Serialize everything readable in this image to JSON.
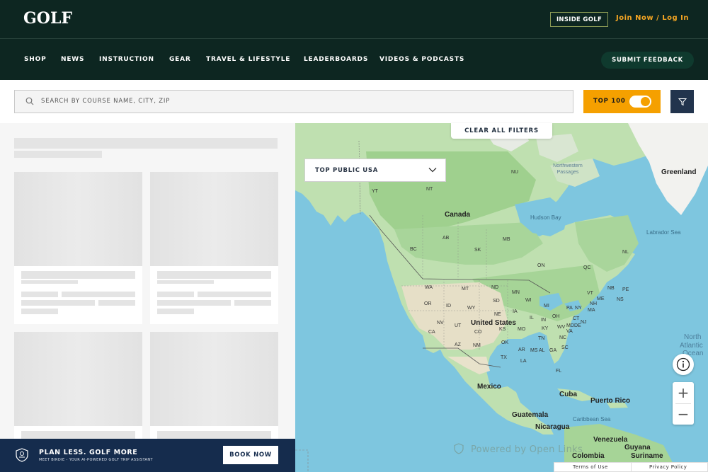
{
  "header": {
    "logo": "GOLF",
    "inside_golf": "INSIDE GOLF",
    "join_login": "Join Now / Log In"
  },
  "nav": {
    "items": [
      "SHOP",
      "NEWS",
      "INSTRUCTION",
      "GEAR",
      "TRAVEL & LIFESTYLE",
      "LEADERBOARDS",
      "VIDEOS & PODCASTS"
    ],
    "feedback": "SUBMIT FEEDBACK"
  },
  "search": {
    "placeholder": "SEARCH BY COURSE NAME, CITY, ZIP",
    "top100_label": "TOP 100",
    "top100_enabled": true
  },
  "map": {
    "clear_filters": "CLEAR ALL FILTERS",
    "dropdown_selected": "TOP PUBLIC USA",
    "powered_by": "Powered by Open Links",
    "footer": {
      "terms": "Terms of Use",
      "privacy": "Privacy Policy"
    },
    "labels": {
      "countries": [
        "Canada",
        "United States",
        "Mexico",
        "Greenland",
        "Cuba",
        "Puerto Rico",
        "Guatemala",
        "Nicaragua",
        "Colombia",
        "Venezuela",
        "Guyana",
        "Suriname"
      ],
      "water": [
        "Hudson Bay",
        "Labrador Sea",
        "Northwestern Passages",
        "Caribbean Sea"
      ],
      "ocean": [
        "North",
        "Atlantic",
        "Ocean"
      ],
      "provinces": [
        "NU",
        "YT",
        "NT",
        "BC",
        "AB",
        "SK",
        "MB",
        "ON",
        "QC",
        "NL",
        "NB",
        "NS",
        "PE"
      ],
      "states": [
        "WA",
        "OR",
        "ID",
        "MT",
        "WY",
        "ND",
        "SD",
        "MN",
        "WI",
        "MI",
        "NV",
        "UT",
        "CO",
        "NE",
        "IA",
        "IL",
        "IN",
        "OH",
        "PA",
        "NY",
        "VT",
        "NH",
        "ME",
        "MA",
        "CT",
        "NJ",
        "DE",
        "MD",
        "CA",
        "AZ",
        "NM",
        "KS",
        "MO",
        "KY",
        "WV",
        "VA",
        "OK",
        "AR",
        "TN",
        "NC",
        "SC",
        "TX",
        "LA",
        "MS",
        "AL",
        "GA",
        "FL"
      ]
    }
  },
  "promo": {
    "title": "PLAN LESS. GOLF MORE",
    "subtitle": "MEET BIRDIE - YOUR AI-POWERED GOLF TRIP ASSISTANT",
    "button": "BOOK NOW"
  }
}
